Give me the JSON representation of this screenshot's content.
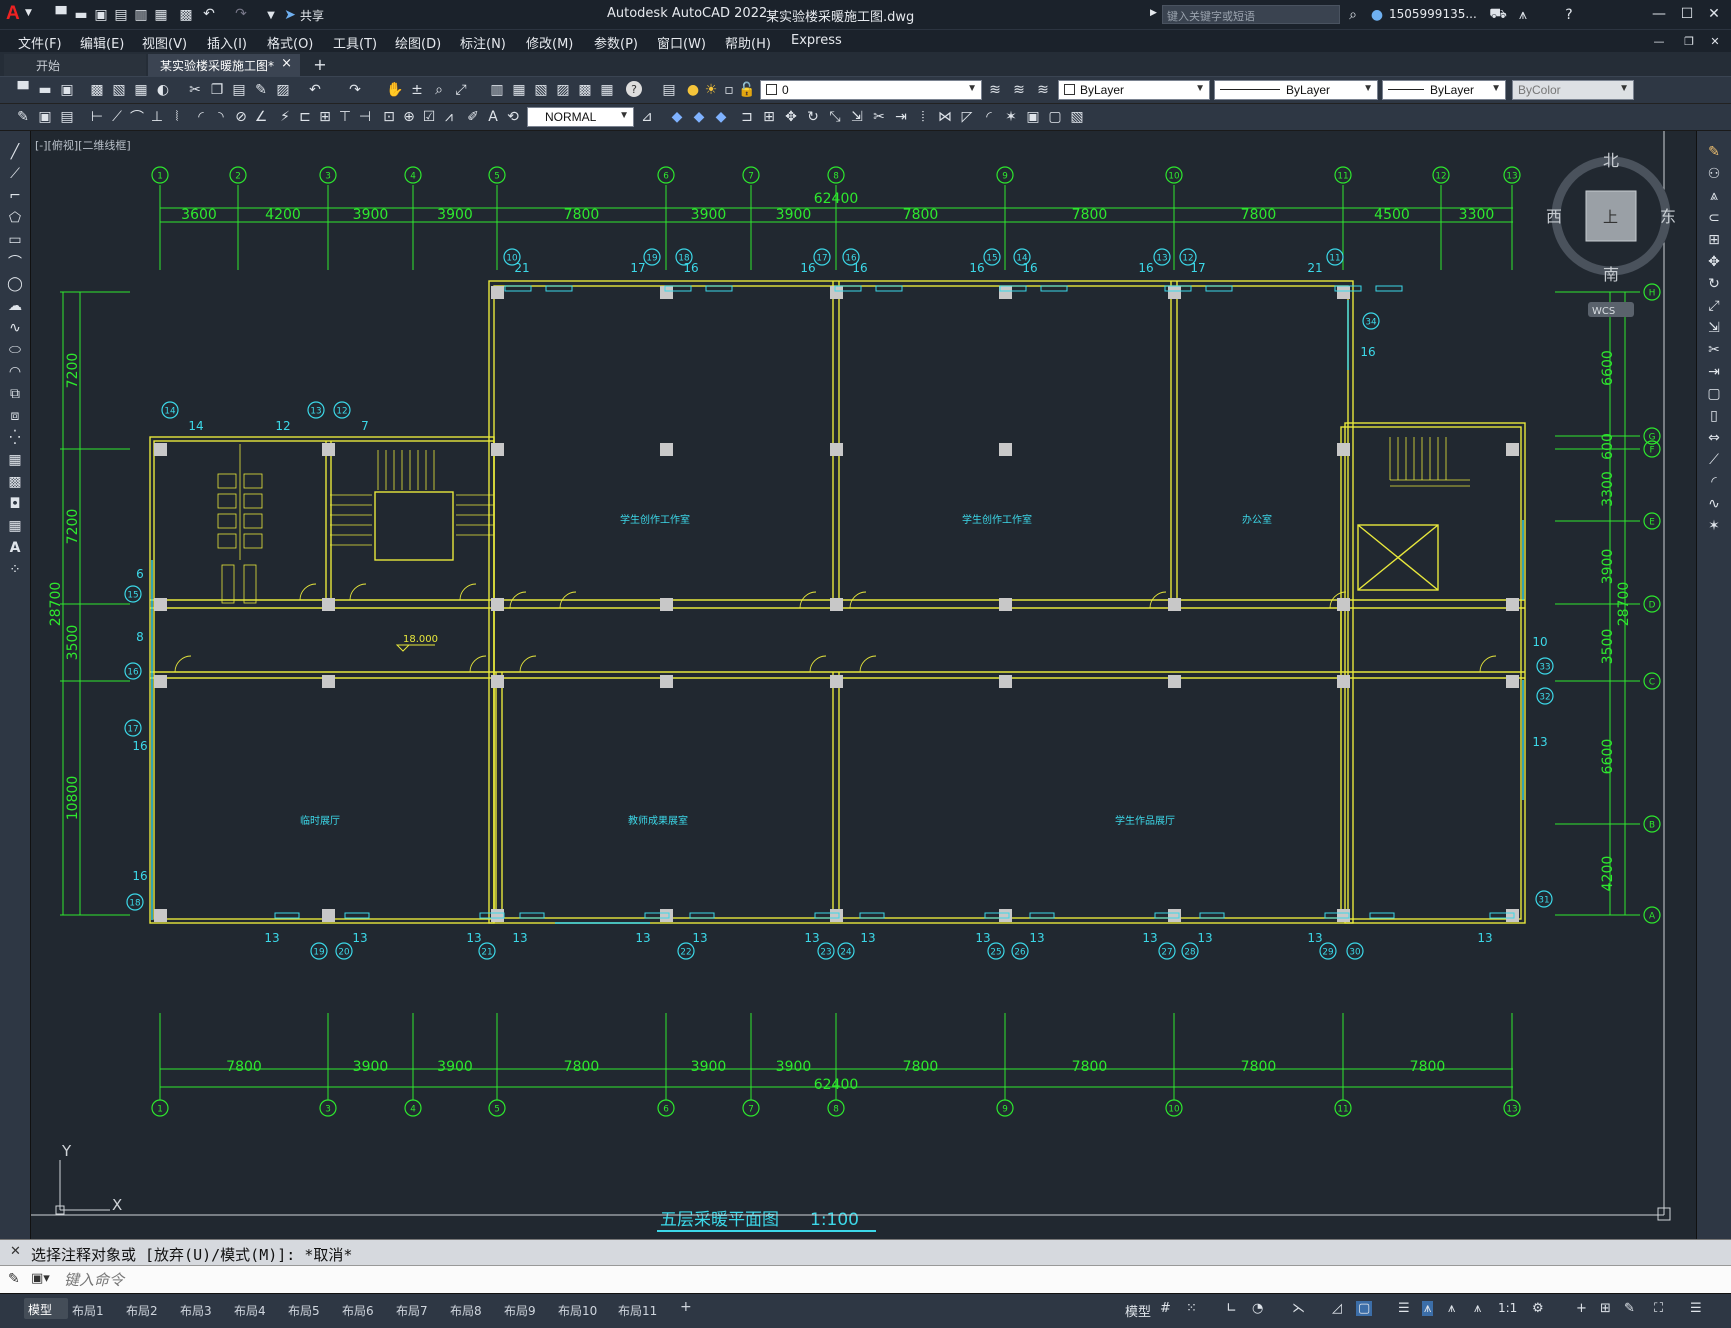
{
  "app": {
    "logo": "A",
    "title": "Autodesk AutoCAD 2022",
    "file_title": "某实验楼采暖施工图.dwg",
    "share_label": "共享",
    "search_placeholder": "键入关键字或短语",
    "user": "1505999135..."
  },
  "menus": [
    "文件(F)",
    "编辑(E)",
    "视图(V)",
    "插入(I)",
    "格式(O)",
    "工具(T)",
    "绘图(D)",
    "标注(N)",
    "修改(M)",
    "参数(P)",
    "窗口(W)",
    "帮助(H)",
    "Express"
  ],
  "doc_tabs": {
    "start": "开始",
    "active": "某实验楼采暖施工图*"
  },
  "properties": {
    "layer": "0",
    "color": "ByLayer",
    "linetype": "ByLayer",
    "lineweight": "ByLayer",
    "plotstyle": "ByColor",
    "dimstyle": "NORMAL"
  },
  "viewport_label": "[-][俯视][二维线框]",
  "viewcube": {
    "north": "北",
    "south": "南",
    "west": "西",
    "east": "东",
    "top": "上",
    "wcs": "WCS"
  },
  "drawing": {
    "grid_top": [
      "1",
      "2",
      "3",
      "4",
      "5",
      "6",
      "7",
      "8",
      "9",
      "10",
      "11",
      "12",
      "13"
    ],
    "grid_bottom": [
      "1",
      "3",
      "4",
      "5",
      "6",
      "7",
      "8",
      "9",
      "10",
      "11",
      "13"
    ],
    "grid_right": [
      "H",
      "G",
      "F",
      "E",
      "D",
      "C",
      "B",
      "A"
    ],
    "top_dims": [
      "3600",
      "4200",
      "3900",
      "3900",
      "7800",
      "3900",
      "3900",
      "7800",
      "7800",
      "7800",
      "4500",
      "3300"
    ],
    "top_total": "62400",
    "bottom_dims": [
      "7800",
      "3900",
      "3900",
      "7800",
      "3900",
      "3900",
      "7800",
      "7800",
      "7800",
      "7800"
    ],
    "bottom_total": "62400",
    "left_dims": [
      "7200",
      "7200",
      "3500",
      "10800"
    ],
    "left_total": "28700",
    "right_dims": [
      "6600",
      "600",
      "3300",
      "3900",
      "3500",
      "6600",
      "4200"
    ],
    "right_total": "28700",
    "rooms": [
      "学生创作工作室",
      "学生创作工作室",
      "办公室",
      "临时展厅",
      "教师成果展室",
      "学生作品展厅"
    ],
    "elevation": "18.000",
    "title": "五层采暖平面图",
    "scale": "1:100",
    "top_numbers": [
      "21",
      "17",
      "16",
      "16",
      "16",
      "16",
      "16",
      "16",
      "17",
      "21"
    ],
    "top_circles": [
      "10",
      "19",
      "18",
      "17",
      "16",
      "15",
      "14",
      "13",
      "12",
      "11"
    ],
    "bottom_numbers": [
      "13",
      "13",
      "13",
      "13",
      "13",
      "13",
      "13",
      "13",
      "13",
      "13",
      "13",
      "13",
      "13",
      "13"
    ],
    "bottom_circles": [
      "19",
      "20",
      "21",
      "22",
      "23",
      "24",
      "25",
      "26",
      "27",
      "28",
      "29",
      "30"
    ],
    "left_circles": [
      "14",
      "13",
      "12",
      "15",
      "16",
      "17",
      "18"
    ],
    "left_numbers": [
      "14",
      "12",
      "7"
    ],
    "right_circles": [
      "34",
      "33",
      "32",
      "31"
    ],
    "left_side_numbers": [
      "6",
      "8",
      "16",
      "16"
    ],
    "right_side_numbers": [
      "16",
      "10",
      "13"
    ]
  },
  "command": {
    "history": "选择注释对象或 [放弃(U)/模式(M)]: *取消*",
    "placeholder": "键入命令"
  },
  "layouts": [
    "模型",
    "布局1",
    "布局2",
    "布局3",
    "布局4",
    "布局5",
    "布局6",
    "布局7",
    "布局8",
    "布局9",
    "布局10",
    "布局11"
  ],
  "status": {
    "model": "模型",
    "scale": "1:1"
  },
  "colors": {
    "grid_green": "#2ee82e",
    "wall_yellow": "#e8e83c",
    "pipe_cyan": "#3cd8e8",
    "background": "#212830"
  }
}
